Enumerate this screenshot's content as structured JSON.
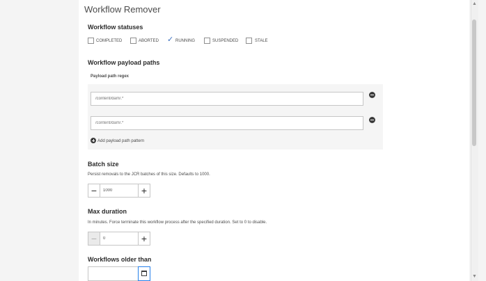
{
  "page": {
    "title": "Workflow Remover"
  },
  "statuses": {
    "title": "Workflow statuses",
    "options": [
      {
        "label": "COMPLETED",
        "checked": false
      },
      {
        "label": "ABORTED",
        "checked": false
      },
      {
        "label": "RUNNING",
        "checked": true
      },
      {
        "label": "SUSPENDED",
        "checked": false
      },
      {
        "label": "STALE",
        "checked": false
      }
    ]
  },
  "payload": {
    "title": "Workflow payload paths",
    "subtitle": "Payload path regex",
    "fields": [
      {
        "value": "/content/dam/.*",
        "placeholder": "/content/dam/.*"
      },
      {
        "value": "",
        "placeholder": "/content/dam/.*"
      }
    ],
    "add_label": "Add payload path pattern"
  },
  "batch": {
    "title": "Batch size",
    "description": "Persist removals to the JCR batches of this size. Defaults to 1000.",
    "value": "1000",
    "minus": "−",
    "plus": "+"
  },
  "duration": {
    "title": "Max duration",
    "description": "In minutes. Force terminate this workflow process after the specified duration. Set to 0 to disable.",
    "value": "0",
    "minus": "−",
    "plus": "+"
  },
  "older": {
    "title": "Workflows older than",
    "value": ""
  },
  "icons": {
    "check": "checkmark-icon",
    "remove": "remove-circle-icon",
    "add": "add-circle-icon",
    "calendar": "calendar-icon"
  },
  "colors": {
    "accent": "#2680eb",
    "check": "#3a6fbf",
    "panel": "#f5f5f5"
  }
}
